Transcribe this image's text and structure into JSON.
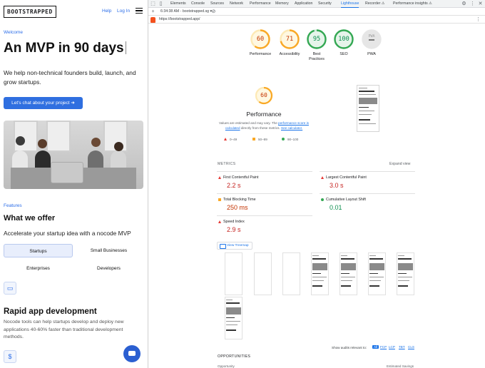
{
  "site": {
    "logo": "BOOTSTRAPPED",
    "nav": {
      "help": "Help",
      "login": "Log In"
    },
    "eyebrow_welcome": "Welcome",
    "hero_title": "An MVP in 90 days",
    "hero_subtitle": "We help non-technical founders build, launch, and grow startups.",
    "cta": "Let's chat about your project ➜",
    "eyebrow_features": "Features",
    "features_title": "What we offer",
    "features_subtitle": "Accelerate your startup idea with a nocode MVP",
    "tabs": [
      "Startups",
      "Small Businesses",
      "Enterprises",
      "Developers"
    ],
    "rapid_title": "Rapid app development",
    "rapid_text": "Nocode tools can help startups develop and deploy new applications 40-60% faster than traditional development methods."
  },
  "devtools": {
    "tabs": [
      "Elements",
      "Console",
      "Sources",
      "Network",
      "Performance",
      "Memory",
      "Application",
      "Security",
      "Lighthouse",
      "Recorder ⚠",
      "Performance insights ⚠"
    ],
    "active_tab": "Lighthouse",
    "report_select": "6:34:38 AM - bootstrapped.sg ▾",
    "url": "https://bootstrapped.app/",
    "scores": [
      {
        "label": "Performance",
        "value": "60",
        "color": "#f9a825",
        "text_color": "#c33300"
      },
      {
        "label": "Accessibility",
        "value": "71",
        "color": "#f9a825",
        "text_color": "#c33300"
      },
      {
        "label": "Best Practices",
        "value": "95",
        "color": "#34a853",
        "text_color": "#0d8f4f"
      },
      {
        "label": "SEO",
        "value": "100",
        "color": "#34a853",
        "text_color": "#0d8f4f"
      },
      {
        "label": "PWA",
        "value": "PWA",
        "color": "#bdbdbd",
        "text_color": "#9e9e9e"
      }
    ],
    "perf_score": "60",
    "perf_title": "Performance",
    "perf_note_1": "Values are estimated and may vary. The",
    "perf_note_link1": "performance score is calculated",
    "perf_note_2": "directly from these metrics.",
    "perf_note_link2": "See calculator.",
    "legend": [
      "0–49",
      "50–89",
      "90–100"
    ],
    "metrics_header": "METRICS",
    "expand_view": "Expand view",
    "metrics": [
      {
        "name": "First Contentful Paint",
        "value": "2.2 s",
        "status": "red"
      },
      {
        "name": "Largest Contentful Paint",
        "value": "3.0 s",
        "status": "red"
      },
      {
        "name": "Total Blocking Time",
        "value": "250 ms",
        "status": "orange"
      },
      {
        "name": "Cumulative Layout Shift",
        "value": "0.01",
        "status": "green"
      },
      {
        "name": "Speed Index",
        "value": "2.9 s",
        "status": "red"
      }
    ],
    "view_treemap": "View Treemap",
    "show_audits_label": "Show audits relevant to:",
    "audit_filters": [
      "All",
      "FCP",
      "LCP",
      "TBT",
      "CLS"
    ],
    "opportunities_header": "OPPORTUNITIES",
    "opportunity_col": "Opportunity",
    "savings_col": "Estimated Savings"
  }
}
